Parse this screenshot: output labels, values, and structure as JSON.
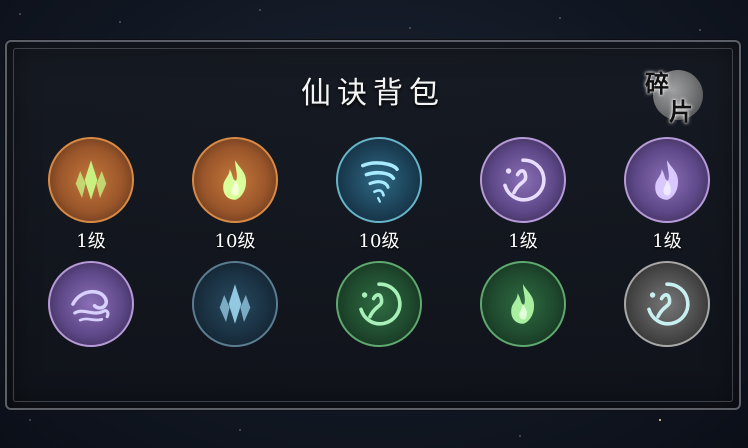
{
  "panel": {
    "title": "仙诀背包",
    "fragment_button": {
      "char1": "碎",
      "char2": "片"
    }
  },
  "items": [
    {
      "icon": "crystal-icon",
      "quality": "orange",
      "level": "1级",
      "glyph_color": "#c9ff8a"
    },
    {
      "icon": "flame-icon",
      "quality": "orange",
      "level": "10级",
      "glyph_color": "#d8ff9a"
    },
    {
      "icon": "whirlwind-icon",
      "quality": "blue",
      "level": "10级",
      "glyph_color": "#a8eaff"
    },
    {
      "icon": "dragon-ring-icon",
      "quality": "purple",
      "level": "1级",
      "glyph_color": "#e8dcff"
    },
    {
      "icon": "flame-icon",
      "quality": "purple",
      "level": "1级",
      "glyph_color": "#d8c8ff"
    },
    {
      "icon": "wave-icon",
      "quality": "purple",
      "level": "",
      "glyph_color": "#d8d0ff"
    },
    {
      "icon": "crystal-icon",
      "quality": "blue",
      "level": "",
      "glyph_color": "#9fd6f0"
    },
    {
      "icon": "dragon-ring-icon",
      "quality": "green",
      "level": "",
      "glyph_color": "#a8f0b8"
    },
    {
      "icon": "flame-icon",
      "quality": "green",
      "level": "",
      "glyph_color": "#a8f0a0"
    },
    {
      "icon": "dragon-ring-icon",
      "quality": "grey",
      "level": "",
      "glyph_color": "#c8f0f0"
    }
  ]
}
